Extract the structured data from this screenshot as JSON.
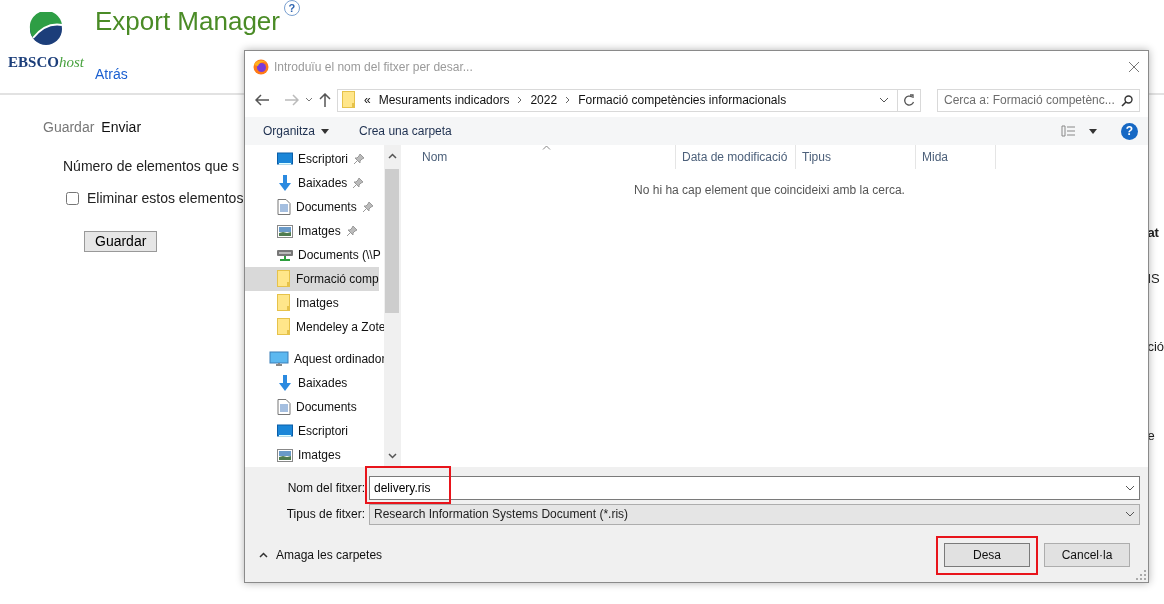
{
  "page": {
    "logo": {
      "brand": "EBSCO",
      "suffix": "host"
    },
    "title": "Export Manager",
    "help": "?",
    "back_link": "Atrás",
    "tabs": [
      {
        "label": "Guardar",
        "selected": true
      },
      {
        "label": "Enviar",
        "selected": false
      }
    ],
    "count_label": "Número de elementos que s",
    "remove_option": {
      "label": "Eliminar estos elementos",
      "checked": false
    },
    "save_button": "Guardar",
    "right_fragments": [
      {
        "text": "at",
        "bold": true
      },
      {
        "text": "IS",
        "bold": false
      },
      {
        "text": "ció",
        "bold": false
      },
      {
        "text": "e",
        "bold": false
      }
    ]
  },
  "dialog": {
    "title": "Introduïu el nom del fitxer per desar...",
    "overflow": "«",
    "breadcrumb": [
      "Mesuraments indicadors",
      "2022",
      "Formació competències informacionals"
    ],
    "search": {
      "placeholder": "Cerca a: Formació competènc..."
    },
    "toolbar": [
      {
        "label": "Organitza",
        "menu": true
      },
      {
        "label": "Crea una carpeta",
        "menu": false
      }
    ],
    "help": "?",
    "nav_items": [
      {
        "label": "Escriptori",
        "kind": "desktop",
        "pinned": true,
        "selected": false
      },
      {
        "label": "Baixades",
        "kind": "download",
        "pinned": true,
        "selected": false
      },
      {
        "label": "Documents",
        "kind": "document",
        "pinned": true,
        "selected": false
      },
      {
        "label": "Imatges",
        "kind": "pictures",
        "pinned": true,
        "selected": false
      },
      {
        "label": "Documents (\\\\P",
        "kind": "drive",
        "pinned": false,
        "selected": false
      },
      {
        "label": "Formació comp",
        "kind": "folder",
        "pinned": false,
        "selected": true
      },
      {
        "label": "Imatges",
        "kind": "folder",
        "pinned": false,
        "selected": false
      },
      {
        "label": "Mendeley a Zote",
        "kind": "folder",
        "pinned": false,
        "selected": false
      }
    ],
    "this_pc": {
      "label": "Aquest ordinador",
      "children": [
        {
          "label": "Baixades",
          "kind": "download"
        },
        {
          "label": "Documents",
          "kind": "document"
        },
        {
          "label": "Escriptori",
          "kind": "desktop"
        },
        {
          "label": "Imatges",
          "kind": "pictures"
        }
      ]
    },
    "columns": [
      "Nom",
      "Data de modificació",
      "Tipus",
      "Mida"
    ],
    "empty_message": "No hi ha cap element que coincideixi amb la cerca.",
    "filename": {
      "label": "Nom del fitxer:",
      "value": "delivery.ris",
      "highlighted": true
    },
    "filetype": {
      "label": "Tipus de fitxer:",
      "value": "Research Information Systems Document (*.ris)"
    },
    "hide_folders": "Amaga les carpetes",
    "buttons": [
      {
        "label": "Desa",
        "highlighted": true
      },
      {
        "label": "Cancel·la",
        "highlighted": false
      }
    ]
  }
}
